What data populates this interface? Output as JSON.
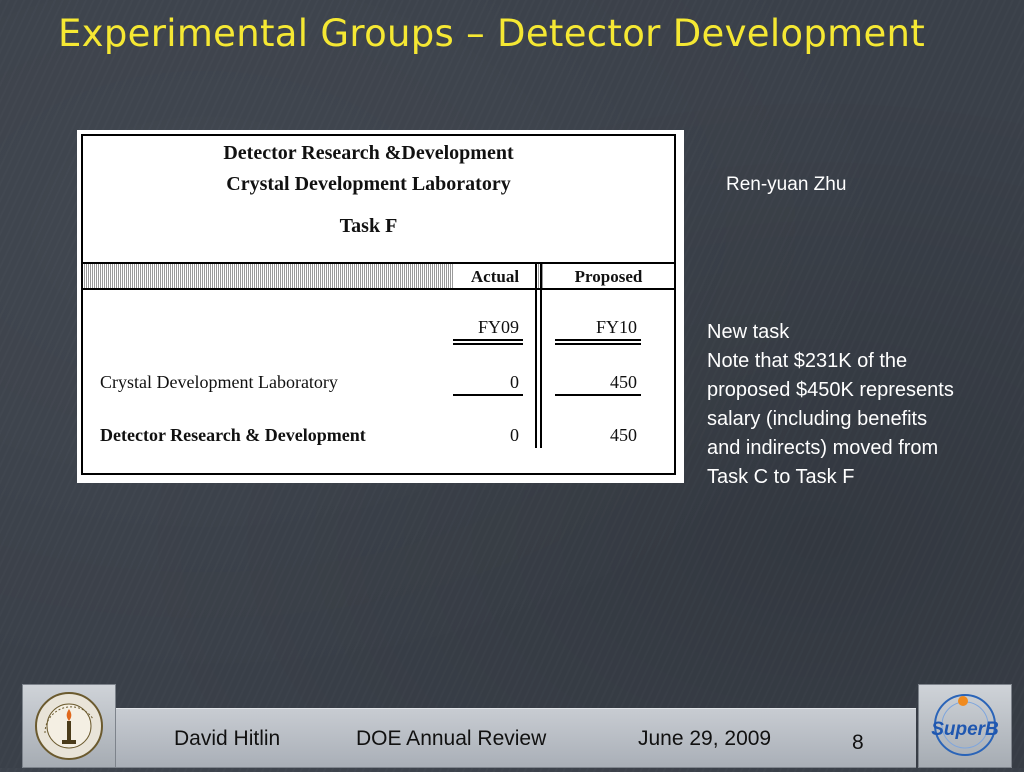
{
  "slide": {
    "title": "Experimental Groups – Detector Development",
    "author": "Ren-yuan Zhu",
    "notes": [
      "New task",
      "Note that $231K of the",
      "proposed $450K represents",
      "salary (including benefits",
      "and indirects) moved from",
      "Task C to Task F"
    ]
  },
  "table": {
    "heading_lines": [
      "Detector Research &Development",
      "Crystal Development Laboratory",
      "Task F"
    ],
    "col_actual": "Actual",
    "col_proposed": "Proposed",
    "fy_actual": "FY09",
    "fy_proposed": "FY10",
    "rows": [
      {
        "label": "Crystal Development Laboratory",
        "actual": "0",
        "proposed": "450"
      },
      {
        "label": "Detector Research & Development",
        "actual": "0",
        "proposed": "450"
      }
    ]
  },
  "footer": {
    "presenter": "David Hitlin",
    "event": "DOE Annual Review",
    "date": "June 29, 2009",
    "page": "8",
    "left_logo": "caltech-seal-icon",
    "right_logo": "superb-logo-icon",
    "right_logo_text": "SuperB"
  },
  "colors": {
    "title": "#f5e833",
    "background": "#3a4049",
    "text": "#ffffff"
  }
}
